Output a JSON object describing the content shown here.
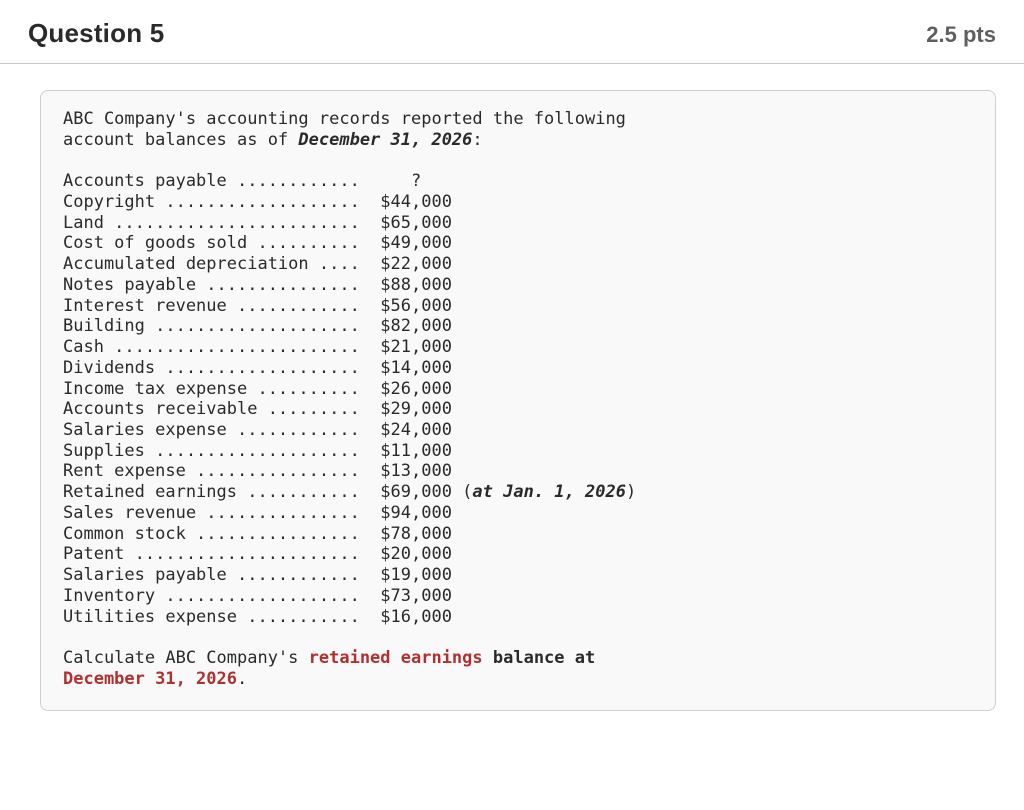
{
  "header": {
    "title": "Question 5",
    "points": "2.5 pts"
  },
  "intro": {
    "line1": "ABC Company's accounting records reported the following",
    "line2_prefix": "account balances as of ",
    "line2_em": "December 31, 2026",
    "line2_suffix": ":"
  },
  "accounts": [
    {
      "label": "Accounts payable ............",
      "value": "   ?"
    },
    {
      "label": "Copyright ...................",
      "value": "$44,000"
    },
    {
      "label": "Land ........................",
      "value": "$65,000"
    },
    {
      "label": "Cost of goods sold ..........",
      "value": "$49,000"
    },
    {
      "label": "Accumulated depreciation ....",
      "value": "$22,000"
    },
    {
      "label": "Notes payable ...............",
      "value": "$88,000"
    },
    {
      "label": "Interest revenue ............",
      "value": "$56,000"
    },
    {
      "label": "Building ....................",
      "value": "$82,000"
    },
    {
      "label": "Cash ........................",
      "value": "$21,000"
    },
    {
      "label": "Dividends ...................",
      "value": "$14,000"
    },
    {
      "label": "Income tax expense ..........",
      "value": "$26,000"
    },
    {
      "label": "Accounts receivable .........",
      "value": "$29,000"
    },
    {
      "label": "Salaries expense ............",
      "value": "$24,000"
    },
    {
      "label": "Supplies ....................",
      "value": "$11,000"
    },
    {
      "label": "Rent expense ................",
      "value": "$13,000"
    },
    {
      "label": "Retained earnings ...........",
      "value": "$69,000",
      "note_prefix": " (",
      "note_em": "at Jan. 1, 2026",
      "note_suffix": ")"
    },
    {
      "label": "Sales revenue ...............",
      "value": "$94,000"
    },
    {
      "label": "Common stock ................",
      "value": "$78,000"
    },
    {
      "label": "Patent ......................",
      "value": "$20,000"
    },
    {
      "label": "Salaries payable ............",
      "value": "$19,000"
    },
    {
      "label": "Inventory ...................",
      "value": "$73,000"
    },
    {
      "label": "Utilities expense ...........",
      "value": "$16,000"
    }
  ],
  "prompt": {
    "line1_prefix": "Calculate ABC Company's ",
    "line1_red": "retained earnings",
    "line1_bold": " balance at",
    "line2_red": "December 31, 2026",
    "line2_suffix": "."
  }
}
